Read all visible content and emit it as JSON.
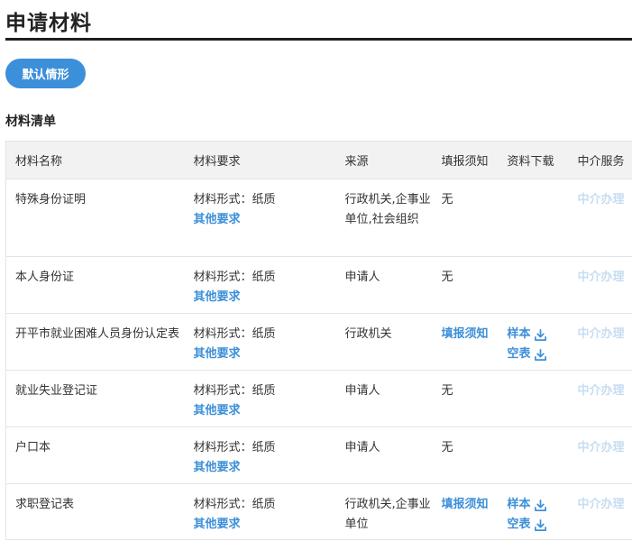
{
  "header": {
    "title": "申请材料",
    "default_button": "默认情形",
    "section_title": "材料清单"
  },
  "table": {
    "columns": [
      "材料名称",
      "材料要求",
      "来源",
      "填报须知",
      "资料下载",
      "中介服务"
    ],
    "form_prefix": "材料形式：",
    "other_requirements": "其他要求",
    "download_labels": {
      "sample": "样本",
      "blank": "空表"
    },
    "rows": [
      {
        "name": "特殊身份证明",
        "form": "纸质",
        "source": "行政机关,企事业单位,社会组织",
        "notice": "无",
        "notice_link": false,
        "download": false,
        "service": "中介办理"
      },
      {
        "name": "本人身份证",
        "form": "纸质",
        "source": "申请人",
        "notice": "无",
        "notice_link": false,
        "download": false,
        "service": "中介办理"
      },
      {
        "name": "开平市就业困难人员身份认定表",
        "form": "纸质",
        "source": "行政机关",
        "notice": "填报须知",
        "notice_link": true,
        "download": true,
        "service": "中介办理"
      },
      {
        "name": "就业失业登记证",
        "form": "纸质",
        "source": "申请人",
        "notice": "无",
        "notice_link": false,
        "download": false,
        "service": "中介办理"
      },
      {
        "name": "户口本",
        "form": "纸质",
        "source": "申请人",
        "notice": "无",
        "notice_link": false,
        "download": false,
        "service": "中介办理"
      },
      {
        "name": "求职登记表",
        "form": "纸质",
        "source": "行政机关,企事业单位",
        "notice": "填报须知",
        "notice_link": true,
        "download": true,
        "service": "中介办理"
      }
    ]
  },
  "icons": {
    "download": "download-icon"
  },
  "colors": {
    "accent": "#3c8fd9",
    "service_link": "#c7ddf1",
    "header_bg": "#f2f2f2"
  }
}
